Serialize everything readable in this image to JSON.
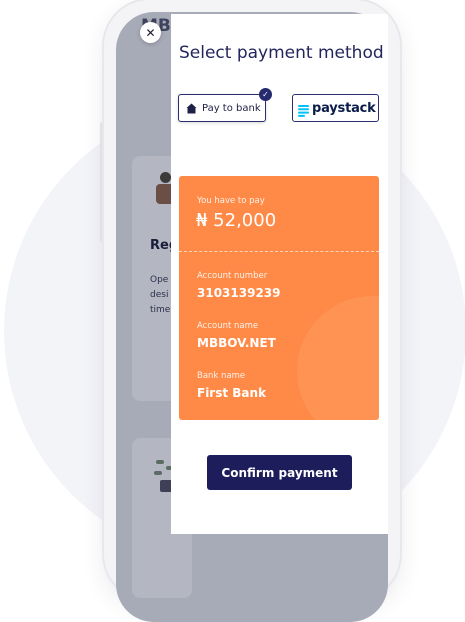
{
  "background_app": {
    "brand": "MB",
    "heading": "Reg",
    "text_lines": [
      "Ope",
      "desi",
      "time"
    ]
  },
  "sheet": {
    "title": "Select payment method",
    "close_icon": "close-icon",
    "methods": [
      {
        "label": "Pay to bank",
        "icon": "home-icon",
        "selected": true
      },
      {
        "label": "paystack",
        "icon": "paystack-logo-icon",
        "selected": false
      }
    ]
  },
  "payment": {
    "amount_label": "You have to pay",
    "amount": "₦ 52,000",
    "account_number_label": "Account number",
    "account_number": "3103139239",
    "account_name_label": "Account name",
    "account_name": "MBBOV.NET",
    "bank_name_label": "Bank name",
    "bank_name": "First Bank"
  },
  "confirm_label": "Confirm payment",
  "colors": {
    "primary": "#1d1d5c",
    "accent": "#ff8a47",
    "paystack_blue": "#00c3f7"
  }
}
